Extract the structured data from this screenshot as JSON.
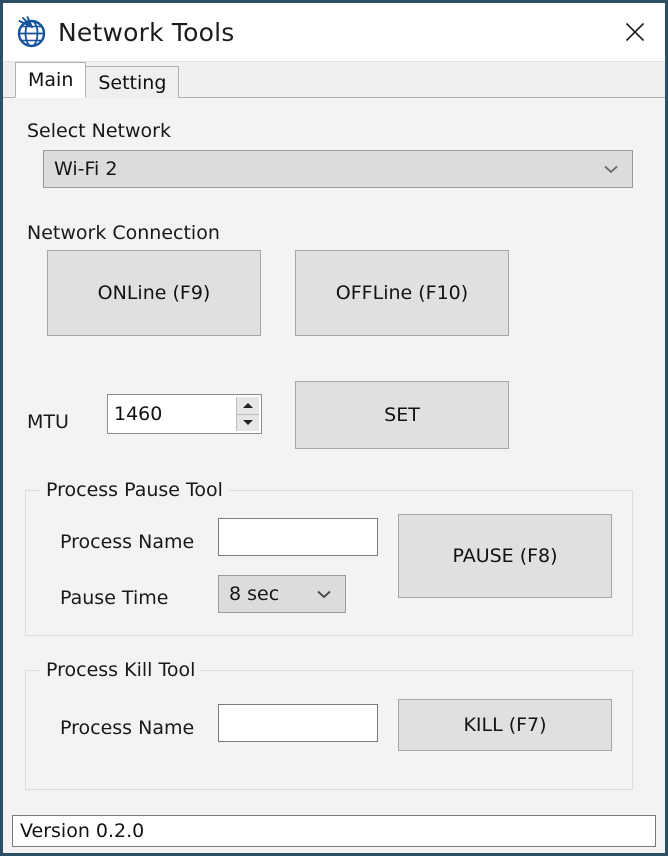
{
  "window": {
    "title": "Network Tools",
    "icon": "globe-network-icon",
    "close_label": "✕",
    "border_color": "#2c4f63"
  },
  "tabs": [
    {
      "label": "Main",
      "active": true
    },
    {
      "label": "Setting",
      "active": false
    }
  ],
  "main": {
    "select_network": {
      "label": "Select Network",
      "value": "Wi-Fi 2",
      "options": [
        "Wi-Fi 2"
      ]
    },
    "network_connection": {
      "label": "Network Connection",
      "online_button": "ONLine (F9)",
      "offline_button": "OFFLine (F10)"
    },
    "mtu": {
      "label": "MTU",
      "value": "1460",
      "set_button": "SET"
    },
    "pause_tool": {
      "title": "Process Pause Tool",
      "process_name_label": "Process Name",
      "process_name_value": "",
      "process_name_placeholder": "",
      "pause_time_label": "Pause Time",
      "pause_time_value": "8 sec",
      "pause_time_options": [
        "8 sec"
      ],
      "pause_button": "PAUSE (F8)"
    },
    "kill_tool": {
      "title": "Process Kill Tool",
      "process_name_label": "Process Name",
      "process_name_value": "",
      "process_name_placeholder": "",
      "kill_button": "KILL (F7)"
    }
  },
  "statusbar": {
    "text": "Version 0.2.0"
  }
}
